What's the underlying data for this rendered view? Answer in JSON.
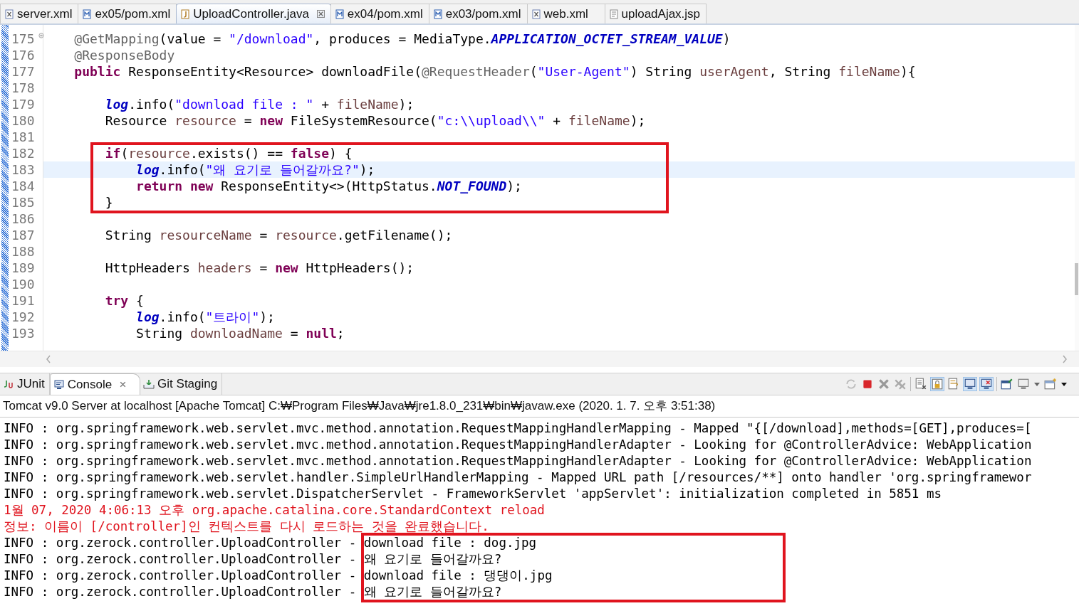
{
  "editor_tabs": [
    {
      "label": "server.xml",
      "kind": "xml",
      "selected": false
    },
    {
      "label": "ex05/pom.xml",
      "kind": "maven",
      "selected": false
    },
    {
      "label": "UploadController.java",
      "kind": "java",
      "selected": true
    },
    {
      "label": "ex04/pom.xml",
      "kind": "maven",
      "selected": false
    },
    {
      "label": "ex03/pom.xml",
      "kind": "maven",
      "selected": false
    },
    {
      "label": "web.xml",
      "kind": "xml",
      "selected": false
    },
    {
      "label": "uploadAjax.jsp",
      "kind": "jsp",
      "selected": false
    }
  ],
  "editor": {
    "sections": [
      {
        "boxed": false,
        "lines": [
          {
            "number": "175",
            "current": false,
            "tokens": [
              {
                "kind": "annotation",
                "text": "    @GetMapping"
              },
              {
                "kind": "plain",
                "text": "(value = "
              },
              {
                "kind": "string",
                "text": "\"/download\""
              },
              {
                "kind": "plain",
                "text": ", produces = MediaType."
              },
              {
                "kind": "constant",
                "text": "APPLICATION_OCTET_STREAM_VALUE"
              },
              {
                "kind": "plain",
                "text": ")"
              }
            ]
          },
          {
            "number": "176",
            "current": false,
            "tokens": [
              {
                "kind": "annotation",
                "text": "    @ResponseBody"
              }
            ]
          },
          {
            "number": "177",
            "current": false,
            "tokens": [
              {
                "kind": "keyword",
                "text": "    public"
              },
              {
                "kind": "plain",
                "text": " ResponseEntity<Resource> downloadFile("
              },
              {
                "kind": "annotation",
                "text": "@RequestHeader"
              },
              {
                "kind": "plain",
                "text": "("
              },
              {
                "kind": "string",
                "text": "\"User-Agent\""
              },
              {
                "kind": "plain",
                "text": ") String "
              },
              {
                "kind": "variable",
                "text": "userAgent"
              },
              {
                "kind": "plain",
                "text": ", String "
              },
              {
                "kind": "variable",
                "text": "fileName"
              },
              {
                "kind": "plain",
                "text": "){"
              }
            ]
          },
          {
            "number": "178",
            "current": false
          },
          {
            "number": "179",
            "current": false,
            "tokens": [
              {
                "kind": "constant",
                "text": "        log"
              },
              {
                "kind": "plain",
                "text": ".info("
              },
              {
                "kind": "string",
                "text": "\"download file : \""
              },
              {
                "kind": "plain",
                "text": " + "
              },
              {
                "kind": "variable",
                "text": "fileName"
              },
              {
                "kind": "plain",
                "text": ");"
              }
            ]
          },
          {
            "number": "180",
            "current": false,
            "tokens": [
              {
                "kind": "plain",
                "text": "        Resource "
              },
              {
                "kind": "variable",
                "text": "resource"
              },
              {
                "kind": "plain",
                "text": " = "
              },
              {
                "kind": "keyword",
                "text": "new"
              },
              {
                "kind": "plain",
                "text": " FileSystemResource("
              },
              {
                "kind": "string",
                "text": "\"c:\\\\upload\\\\\""
              },
              {
                "kind": "plain",
                "text": " + "
              },
              {
                "kind": "variable",
                "text": "fileName"
              },
              {
                "kind": "plain",
                "text": ");"
              }
            ]
          },
          {
            "number": "181",
            "current": false
          }
        ]
      },
      {
        "boxed": true,
        "lines": [
          {
            "number": "182",
            "current": false,
            "tokens": [
              {
                "kind": "keyword",
                "text": "        if"
              },
              {
                "kind": "plain",
                "text": "("
              },
              {
                "kind": "variable",
                "text": "resource"
              },
              {
                "kind": "plain",
                "text": ".exists() == "
              },
              {
                "kind": "keyword",
                "text": "false"
              },
              {
                "kind": "plain",
                "text": ") {"
              }
            ]
          },
          {
            "number": "183",
            "current": true,
            "tokens": [
              {
                "kind": "constant",
                "text": "            log"
              },
              {
                "kind": "plain",
                "text": ".info("
              },
              {
                "kind": "string",
                "text": "\"왜 요기로 들어갈까요?\""
              },
              {
                "kind": "plain",
                "text": ");"
              }
            ]
          },
          {
            "number": "184",
            "current": false,
            "tokens": [
              {
                "kind": "keyword",
                "text": "            return"
              },
              {
                "kind": "keyword",
                "text": " new"
              },
              {
                "kind": "plain",
                "text": " ResponseEntity<>(HttpStatus."
              },
              {
                "kind": "constant",
                "text": "NOT_FOUND"
              },
              {
                "kind": "plain",
                "text": ");"
              }
            ]
          },
          {
            "number": "185",
            "current": false,
            "tokens": [
              {
                "kind": "plain",
                "text": "        }"
              }
            ]
          }
        ]
      },
      {
        "boxed": false,
        "lines": [
          {
            "number": "186",
            "current": false
          },
          {
            "number": "187",
            "current": false,
            "tokens": [
              {
                "kind": "plain",
                "text": "        String "
              },
              {
                "kind": "variable",
                "text": "resourceName"
              },
              {
                "kind": "plain",
                "text": " = "
              },
              {
                "kind": "variable",
                "text": "resource"
              },
              {
                "kind": "plain",
                "text": ".getFilename();"
              }
            ]
          },
          {
            "number": "188",
            "current": false
          },
          {
            "number": "189",
            "current": false,
            "tokens": [
              {
                "kind": "plain",
                "text": "        HttpHeaders "
              },
              {
                "kind": "variable",
                "text": "headers"
              },
              {
                "kind": "plain",
                "text": " = "
              },
              {
                "kind": "keyword",
                "text": "new"
              },
              {
                "kind": "plain",
                "text": " HttpHeaders();"
              }
            ]
          },
          {
            "number": "190",
            "current": false
          },
          {
            "number": "191",
            "current": false,
            "tokens": [
              {
                "kind": "keyword",
                "text": "        try"
              },
              {
                "kind": "plain",
                "text": " {"
              }
            ]
          },
          {
            "number": "192",
            "current": false,
            "tokens": [
              {
                "kind": "constant",
                "text": "            log"
              },
              {
                "kind": "plain",
                "text": ".info("
              },
              {
                "kind": "string",
                "text": "\"트라이\""
              },
              {
                "kind": "plain",
                "text": ");"
              }
            ]
          },
          {
            "number": "193",
            "current": false,
            "tokens": [
              {
                "kind": "plain",
                "text": "            String "
              },
              {
                "kind": "variable",
                "text": "downloadName"
              },
              {
                "kind": "plain",
                "text": " = "
              },
              {
                "kind": "keyword",
                "text": "null"
              },
              {
                "kind": "plain",
                "text": ";"
              }
            ]
          }
        ]
      }
    ]
  },
  "view_tabs": [
    {
      "label": "JUnit",
      "kind": "junit",
      "selected": false
    },
    {
      "label": "Console",
      "kind": "console",
      "selected": true
    },
    {
      "label": "Git Staging",
      "kind": "git",
      "selected": false
    }
  ],
  "console": {
    "title": "Tomcat v9.0 Server at localhost [Apache Tomcat] C:₩Program Files₩Java₩jre1.8.0_231₩bin₩javaw.exe (2020. 1. 7. 오후 3:51:38)",
    "sections": [
      {
        "boxed": false,
        "lines": [
          {
            "kind": "info",
            "source": "INFO : org.springframework.web.servlet.mvc.method.annotation.RequestMappingHandlerMapping - ",
            "message": "Mapped \"{[/download],methods=[GET],produces=["
          },
          {
            "kind": "info",
            "source": "INFO : org.springframework.web.servlet.mvc.method.annotation.RequestMappingHandlerAdapter - ",
            "message": "Looking for @ControllerAdvice: WebApplication"
          },
          {
            "kind": "info",
            "source": "INFO : org.springframework.web.servlet.mvc.method.annotation.RequestMappingHandlerAdapter - ",
            "message": "Looking for @ControllerAdvice: WebApplication"
          },
          {
            "kind": "info",
            "source": "INFO : org.springframework.web.servlet.handler.SimpleUrlHandlerMapping - ",
            "message": "Mapped URL path [/resources/**] onto handler 'org.springframewor"
          },
          {
            "kind": "info",
            "source": "INFO : org.springframework.web.servlet.DispatcherServlet - ",
            "message": "FrameworkServlet 'appServlet': initialization completed in 5851 ms"
          },
          {
            "kind": "error",
            "source": "1월 07, 2020 4:06:13 오후 ",
            "message": "org.apache.catalina.core.StandardContext reload"
          },
          {
            "kind": "error",
            "source": "정보: 이름이 ",
            "message": "[/controller]인 컨텍스트를 다시 로드하는 것을 완료했습니다."
          }
        ]
      },
      {
        "boxed": true,
        "lines": [
          {
            "kind": "info",
            "source": "INFO : org.zerock.controller.UploadController - ",
            "message": "download file : dog.jpg"
          },
          {
            "kind": "info",
            "source": "INFO : org.zerock.controller.UploadController - ",
            "message": "왜 요기로 들어갈까요?"
          },
          {
            "kind": "info",
            "source": "INFO : org.zerock.controller.UploadController - ",
            "message": "download file : 댕댕이.jpg"
          },
          {
            "kind": "info",
            "source": "INFO : org.zerock.controller.UploadController - ",
            "message": "왜 요기로 들어갈까요?"
          }
        ]
      }
    ]
  }
}
